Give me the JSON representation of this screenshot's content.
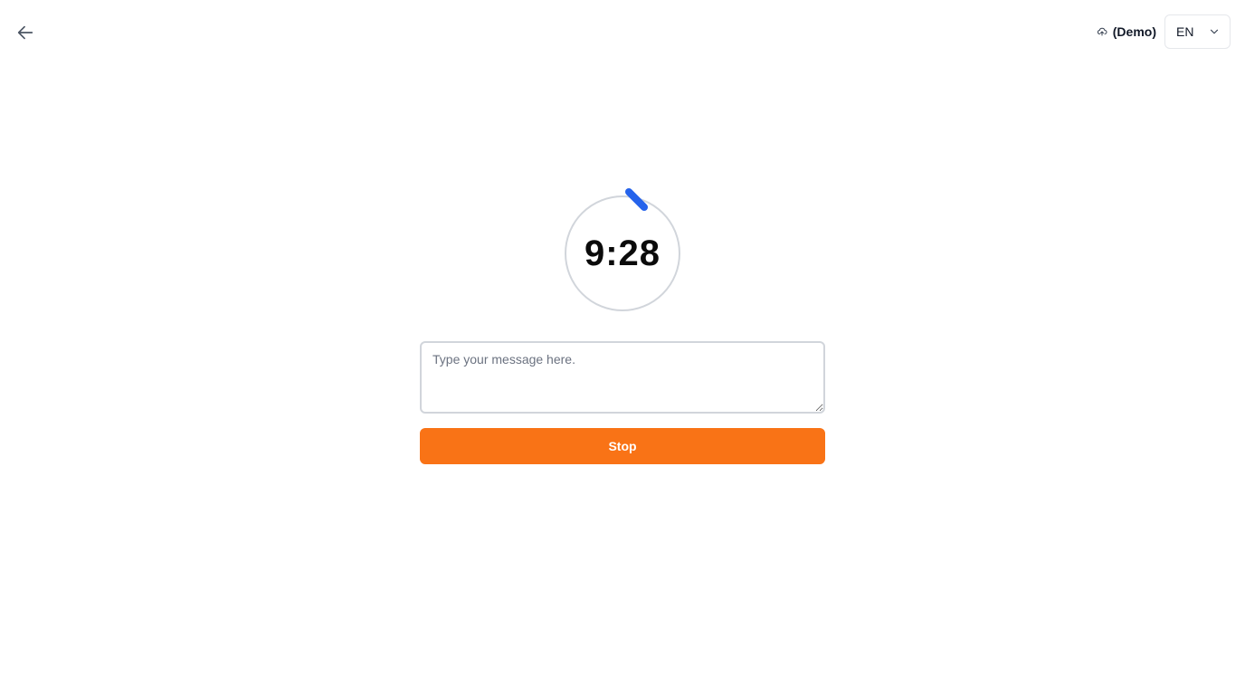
{
  "header": {
    "back_icon": "arrow-left-icon",
    "demo_icon": "cloud-upload-icon",
    "demo_label": "(Demo)",
    "language": {
      "selected": "EN",
      "icon": "chevron-down-icon"
    }
  },
  "timer": {
    "display": "9:28",
    "ring_color": "#d1d5db",
    "progress_color": "#2563eb"
  },
  "message": {
    "value": "",
    "placeholder": "Type your message here."
  },
  "actions": {
    "stop_label": "Stop",
    "stop_color": "#f97316"
  }
}
